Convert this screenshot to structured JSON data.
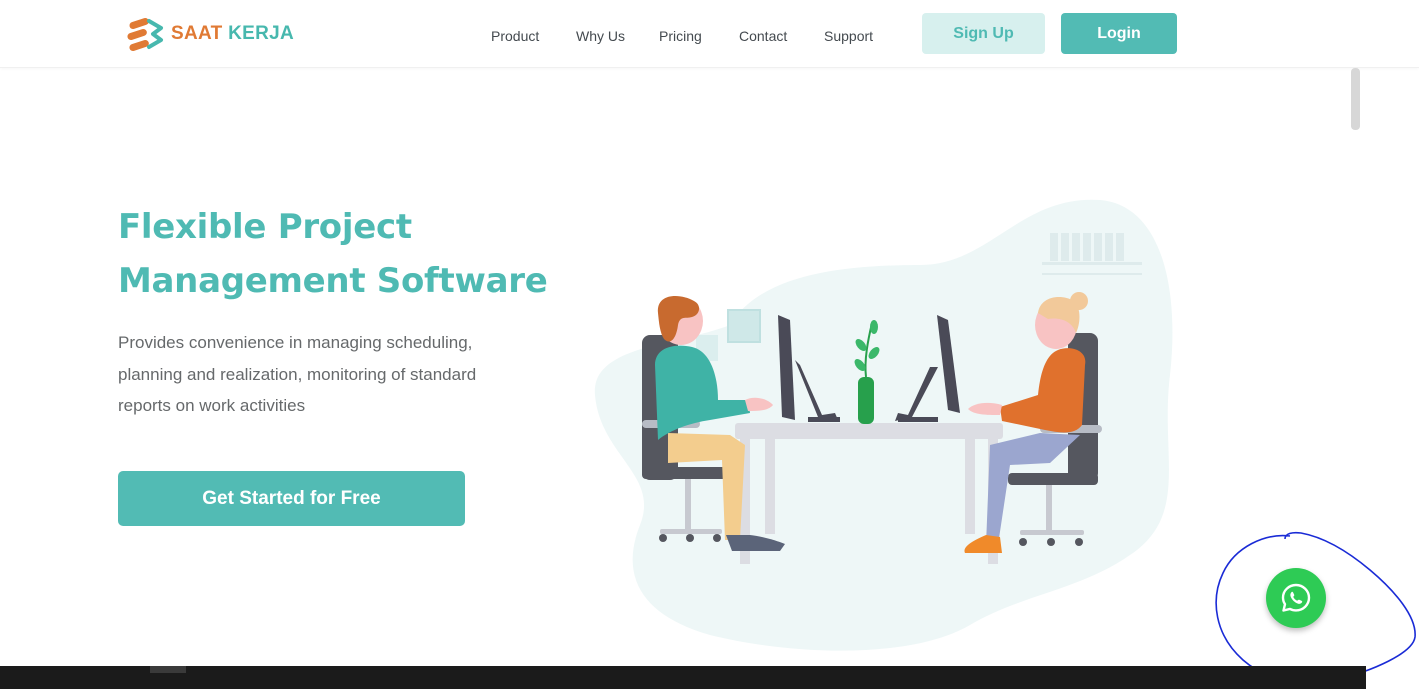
{
  "header": {
    "logo": {
      "word1": "SAAT",
      "word2": "KERJA"
    },
    "nav": [
      {
        "label": "Product"
      },
      {
        "label": "Why Us"
      },
      {
        "label": "Pricing"
      },
      {
        "label": "Contact"
      },
      {
        "label": "Support"
      }
    ],
    "signup_label": "Sign Up",
    "login_label": "Login"
  },
  "hero": {
    "title_line1": "Flexible Project",
    "title_line2": "Management Software",
    "description": "Provides convenience in managing scheduling, planning and realization, monitoring of standard reports on work activities",
    "cta_label": "Get Started for Free"
  },
  "floating": {
    "icon": "whatsapp-icon"
  },
  "colors": {
    "accent": "#52bbb4",
    "accent_light": "#d7f0ee",
    "logo_orange": "#e07a34",
    "whatsapp_green": "#2ecb55",
    "annotation_blue": "#1a2bd6"
  }
}
